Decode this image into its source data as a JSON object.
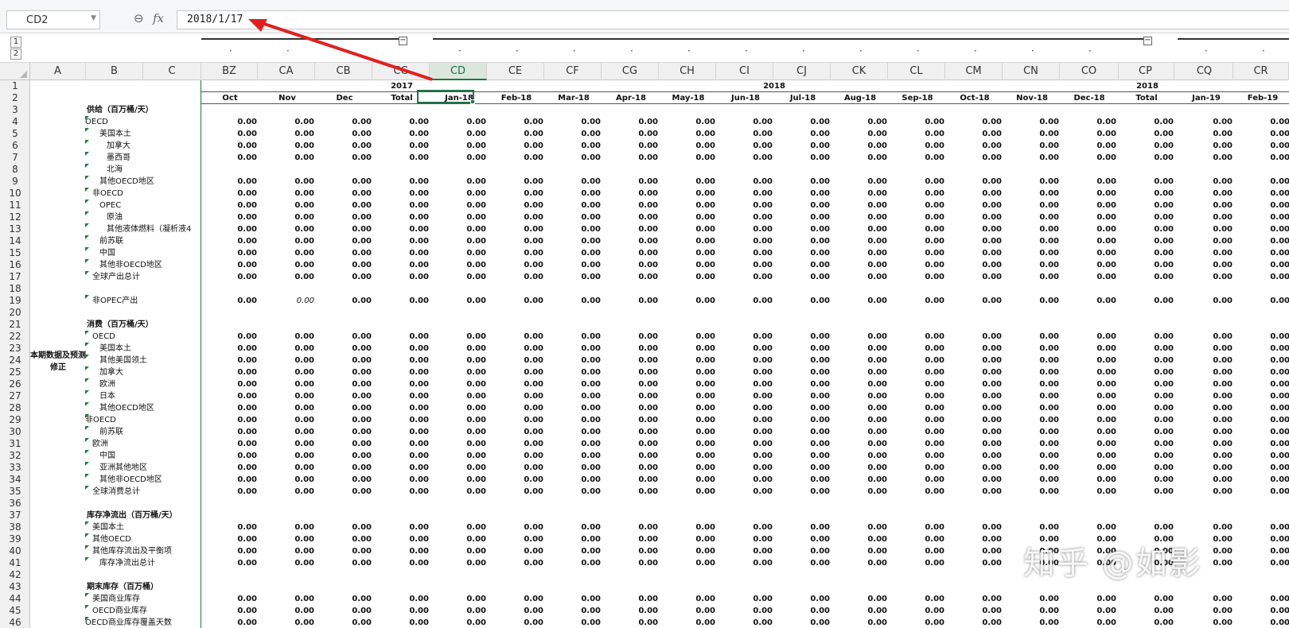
{
  "namebox": "CD2",
  "formula_icons": {
    "zoom": "zoom-icon",
    "fx": "fx"
  },
  "formula": "2018/1/17",
  "levels": [
    "1",
    "2"
  ],
  "collapse_symbol": "−",
  "cols": [
    "A",
    "B",
    "C",
    "BZ",
    "CA",
    "CB",
    "CC",
    "CD",
    "CE",
    "CF",
    "CG",
    "CH",
    "CI",
    "CJ",
    "CK",
    "CL",
    "CM",
    "CN",
    "CO",
    "CP",
    "CQ",
    "CR"
  ],
  "year_labels": [
    "2017",
    "2018",
    "2018"
  ],
  "months": [
    "Oct",
    "Nov",
    "Dec",
    "Total",
    "Jan-18",
    "Feb-18",
    "Mar-18",
    "Apr-18",
    "May-18",
    "Jun-18",
    "Jul-18",
    "Aug-18",
    "Sep-18",
    "Oct-18",
    "Nov-18",
    "Dec-18",
    "Total",
    "Jan-19",
    "Feb-19"
  ],
  "rows": [
    "1",
    "2",
    "3",
    "4",
    "5",
    "6",
    "7",
    "8",
    "9",
    "10",
    "11",
    "12",
    "13",
    "14",
    "15",
    "16",
    "17",
    "18",
    "19",
    "20",
    "21",
    "22",
    "23",
    "24",
    "25",
    "26",
    "27",
    "28",
    "29",
    "30",
    "31",
    "32",
    "33",
    "34",
    "35",
    "36",
    "37",
    "38",
    "39",
    "40",
    "41",
    "42",
    "43",
    "44",
    "45",
    "46"
  ],
  "merged_label": "本期数据及预测修正",
  "labels": [
    "供给（百万桶/天）",
    "OECD",
    "美国本土",
    "加拿大",
    "墨西哥",
    "北海",
    "其他OECD地区",
    "非OECD",
    "OPEC",
    "原油",
    "其他液体燃料（凝析液4",
    "前苏联",
    "中国",
    "其他非OECD地区",
    "全球产出总计",
    "",
    "非OPEC产出",
    "",
    "消费（百万桶/天）",
    "OECD",
    "美国本土",
    "其他美国领土",
    "加拿大",
    "欧洲",
    "日本",
    "其他OECD地区",
    "非OECD",
    "前苏联",
    "欧洲",
    "中国",
    "亚洲其他地区",
    "其他非OECD地区",
    "全球消费总计",
    "",
    "库存净流出（百万桶/天）",
    "美国本土",
    "其他OECD",
    "其他库存流出及平衡项",
    "库存净流出总计",
    "",
    "期末库存（百万桶）",
    "美国商业库存",
    "OECD商业库存",
    "OECD商业库存覆盖天数"
  ],
  "value_text": "0.00",
  "watermark": "知乎 @如影"
}
